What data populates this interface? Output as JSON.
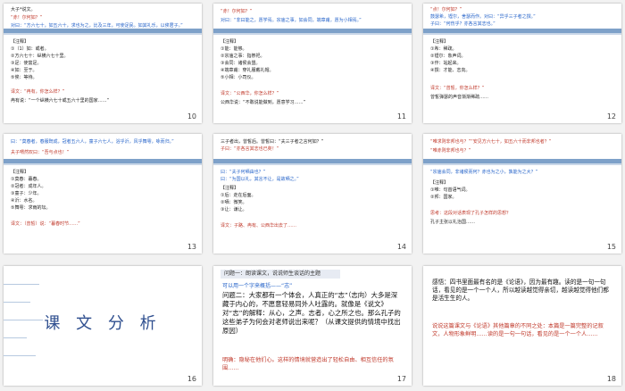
{
  "slides": [
    {
      "number": "10",
      "lines": [
        "大子*说文。",
        "“赤！尔何如？”",
        "对曰：“方六七十，如五六十，求也为之，比及三年，可使足民。如其礼乐，以俟君子。”",
        "【注释】",
        "①（1）如：或者。",
        "②方六七十：纵横六七十里。",
        "③足：使富足。",
        "④如：至于。",
        "⑤俟：等待。",
        "译文：“冉有，你怎么样？”",
        "冉有说：“一个纵横六七十或五六十里的国家……”"
      ]
    },
    {
      "number": "11",
      "lines": [
        "“赤！尔何如？”",
        "对曰：“非曰能之，愿学焉。宗庙之事，如会同，端章甫，愿为小相焉。”",
        "【注释】",
        "①能：能够。",
        "②宗庙之事：指祭祀。",
        "③会同：诸侯会盟。",
        "④端章甫：穿礼服戴礼帽。",
        "⑤小相：小司仪。",
        "译文：“公西华，你怎么样？”",
        "公西华说：“不敢说能做到，愿意学习……”"
      ]
    },
    {
      "number": "12",
      "lines": [
        "“点！尔何如？”",
        "鼓瑟希，铿尔，舍瑟而作。对曰：“异乎三子者之撰。”",
        "子曰：“何伤乎？亦各言其志也。”",
        "【注释】",
        "①希：稀疏。",
        "②铿尔：象声词。",
        "③作：站起来。",
        "④撰：才能、志向。",
        "译文：“曾皙，你怎么样？”",
        "曾皙弹瑟的声音渐渐稀疏……"
      ]
    },
    {
      "number": "13",
      "lines": [
        "曰：“莫春者，春服既成，冠者五六人，童子六七人，浴乎沂，风乎舞雩，咏而归。”",
        "夫子喟然叹曰：“吾与点也！”",
        "【注释】",
        "①莫春：暮春。",
        "②冠者：成年人。",
        "③童子：少年。",
        "④沂：水名。",
        "⑤舞雩：求雨的坛。",
        "译文：（曾皙）说：“暮春时节……”"
      ]
    },
    {
      "number": "14",
      "lines": [
        "三子者出，曾皙后。曾皙曰：“夫三子者之言何如？”",
        "子曰：“亦各言其志也已矣！”",
        "曰：“夫子何哂由也？”",
        "曰：“为国以礼，其言不让，是故哂之。”",
        "【注释】",
        "①后：走在后面。",
        "②哂：微笑。",
        "③让：谦让。",
        "译文：子路、冉有、公西华出去了……"
      ]
    },
    {
      "number": "15",
      "lines": [
        "“唯求则非邦也与？”“安见方六七十，如五六十而非邦也者？”",
        "“唯赤则非邦也与？”",
        "“宗庙会同，非诸侯而何？赤也为之小，孰能为之大？”",
        "【注释】",
        "①唯：句首语气词。",
        "②邦：国家。",
        "思考：这段对话表现了孔子怎样的思想？",
        "孔子主张以礼治国……"
      ]
    },
    {
      "number": "16",
      "title": "课 文 分 析"
    },
    {
      "number": "17",
      "banner": "问题一：朗读课文，说说师生谈话的主题",
      "heading": "可以用一个字来概括——“志”",
      "text": "问题二：大家都有一个体会，人真正的“志”（志向）大多是深藏于内心的，不愿意轻易同外人吐露的。就像是《说文》对“志”的解释：从心，之声。志者，心之所之也。那么孔子的这些弟子为何会对老师说出来呢？（从课文提供的情境中找出原因）",
      "answer": "明确：隐秘在他们心。这样的情境就营造出了轻松自由、相互信任的氛围……"
    },
    {
      "number": "18",
      "text": "感悟：四书里面最有名的是《论语》，因为最有趣。读的是一句一句话，看见的是一个一个人，所以越读越觉得亲切，越读越觉得他们都是活生生的人。",
      "answer": "说说这篇课文与《论语》其他篇章的不同之处：本篇是一篇完整的记叙文，人物形象鲜明……读的是一句一句话，看见的是一个一个人……"
    }
  ]
}
